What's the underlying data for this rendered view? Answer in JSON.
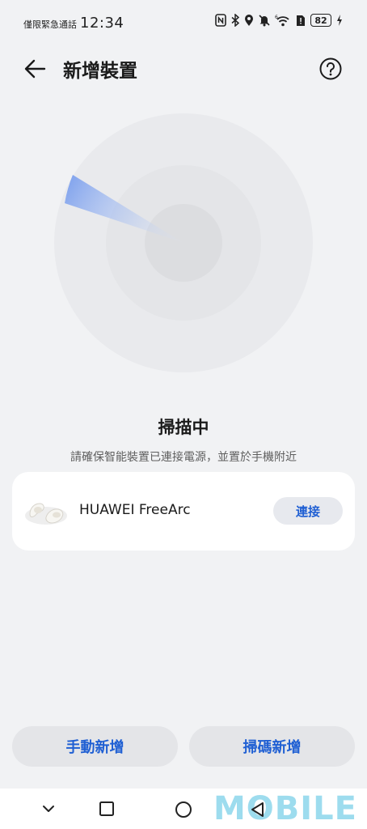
{
  "status_bar": {
    "carrier": "僅限緊急通話",
    "time": "12:34",
    "battery": "82",
    "icons": [
      "nfc-icon",
      "bluetooth-icon",
      "location-icon",
      "mute-icon",
      "wifi-icon",
      "sim-icon",
      "battery-icon",
      "charging-icon"
    ]
  },
  "header": {
    "title": "新增裝置",
    "back_icon": "arrow-left-icon",
    "help_icon": "help-circle-icon"
  },
  "scan": {
    "title": "掃描中",
    "subtitle": "請確保智能裝置已連接電源，並置於手機附近"
  },
  "devices": [
    {
      "name": "HUAWEI FreeArc",
      "action": "連接",
      "image": "earbuds-image"
    }
  ],
  "buttons": {
    "manual_add": "手動新增",
    "scan_add": "掃碼新增"
  },
  "nav_bar": {
    "icons": [
      "chevron-down-icon",
      "square-icon",
      "circle-icon",
      "triangle-back-icon"
    ]
  },
  "watermark": "MOBILE",
  "colors": {
    "accent": "#1f5fd3",
    "background": "#f1f2f4",
    "card": "#ffffff",
    "radar_sweep": "#7fa2ee"
  }
}
